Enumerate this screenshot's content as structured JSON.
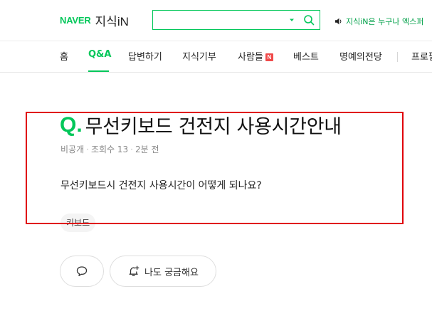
{
  "header": {
    "logo_brand": "NAVER",
    "logo_service": "지식iN",
    "search_value": "",
    "search_placeholder": "",
    "notice_text": "지식iN은 누구나 엑스퍼"
  },
  "nav": {
    "items": [
      {
        "label": "홈"
      },
      {
        "label": "Q&A"
      },
      {
        "label": "답변하기"
      },
      {
        "label": "지식기부"
      },
      {
        "label": "사람들"
      },
      {
        "label": "베스트"
      },
      {
        "label": "명예의전당"
      },
      {
        "label": "프로필"
      }
    ],
    "active_index": 1,
    "new_badge": "N"
  },
  "question": {
    "q_mark": "Q.",
    "title": "무선키보드 건전지 사용시간안내",
    "meta": {
      "visibility": "비공개",
      "views": "조회수 13",
      "time": "2분 전",
      "separator": "·"
    },
    "body": "무선키보드시 건전지 사용시간이 어떻게 되나요?",
    "tag": "키보드"
  },
  "actions": {
    "curious_label": "나도 궁금해요"
  },
  "colors": {
    "brand_green": "#03c75a",
    "highlight_red": "#e0000a",
    "new_badge": "#f04a4a"
  }
}
